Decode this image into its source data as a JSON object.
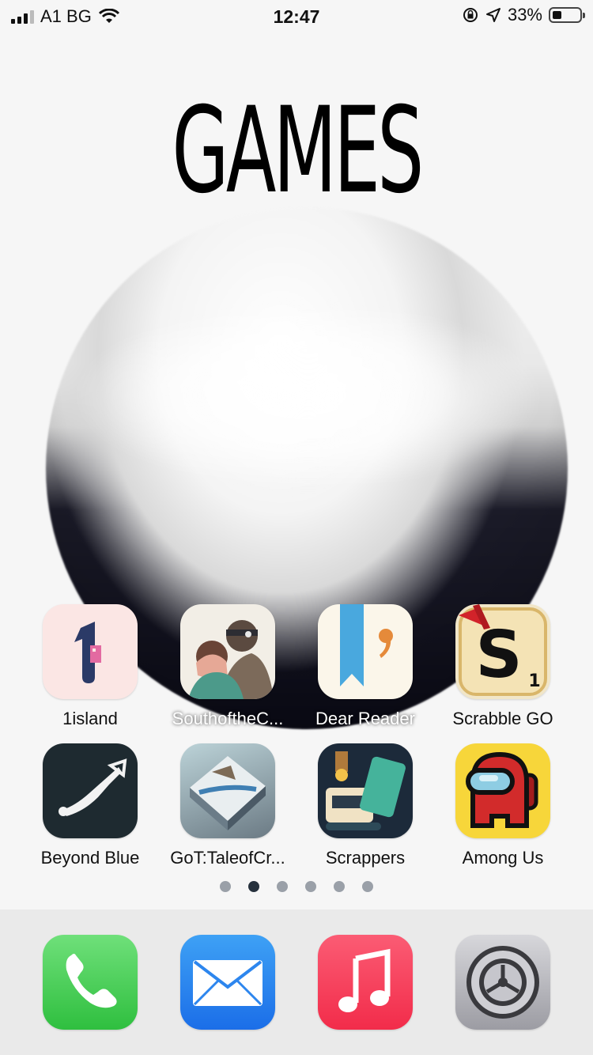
{
  "status": {
    "carrier": "A1 BG",
    "time": "12:47",
    "battery": "33%",
    "battery_level": 0.33
  },
  "wallpaper": {
    "title": "GAMES"
  },
  "apps": [
    {
      "label": "1island",
      "icon": "1island-icon"
    },
    {
      "label": "SouthoftheC...",
      "icon": "south-of-the-circle-icon"
    },
    {
      "label": "Dear Reader",
      "icon": "dear-reader-icon"
    },
    {
      "label": "Scrabble GO",
      "icon": "scrabble-go-icon"
    },
    {
      "label": "Beyond Blue",
      "icon": "beyond-blue-icon"
    },
    {
      "label": "GoT:TaleofCr...",
      "icon": "got-tale-of-crows-icon"
    },
    {
      "label": "Scrappers",
      "icon": "scrappers-icon"
    },
    {
      "label": "Among Us",
      "icon": "among-us-icon"
    }
  ],
  "page_dots": {
    "count": 6,
    "active": 2
  },
  "dock": [
    {
      "label": "Phone",
      "icon": "phone-icon"
    },
    {
      "label": "Mail",
      "icon": "mail-icon"
    },
    {
      "label": "Music",
      "icon": "music-icon"
    },
    {
      "label": "Settings",
      "icon": "settings-icon"
    }
  ],
  "colors": {
    "background": "#f6f6f6",
    "active_dot": "#26313d",
    "inactive_dot": "#9aa0a8"
  }
}
